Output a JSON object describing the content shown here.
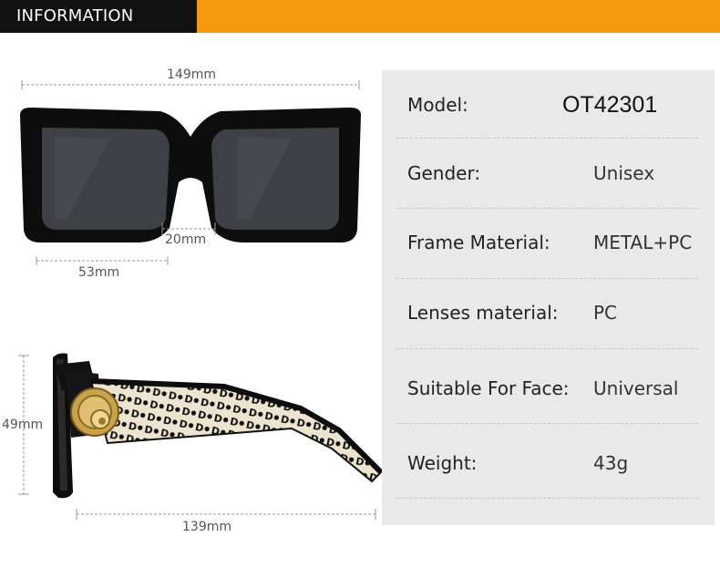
{
  "header": {
    "title": "INFORMATION",
    "accent_color": "#f89a0e"
  },
  "dimensions": {
    "total_width": "149mm",
    "bridge": "20mm",
    "lens_width": "53mm",
    "lens_height": "49mm",
    "temple_length": "139mm"
  },
  "specs": [
    {
      "label": "Model:",
      "value": "OT42301"
    },
    {
      "label": "Gender:",
      "value": "Unisex"
    },
    {
      "label": "Frame Material:",
      "value": "METAL+PC"
    },
    {
      "label": "Lenses material:",
      "value": "PC"
    },
    {
      "label": "Suitable For Face:",
      "value": "Universal"
    },
    {
      "label": "Weight:",
      "value": "43g"
    }
  ],
  "images": {
    "front_view": "sunglasses-front-view",
    "side_view": "sunglasses-side-view"
  }
}
